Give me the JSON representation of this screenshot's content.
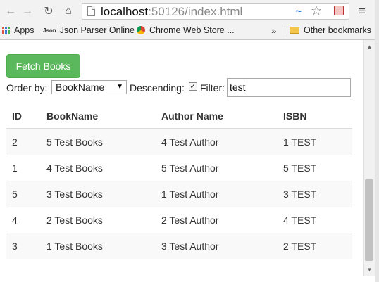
{
  "browser": {
    "url_host": "localhost",
    "url_path": ":50126/index.html",
    "back_icon": "←",
    "forward_icon": "→",
    "reload_icon": "↻",
    "home_icon": "⌂",
    "star_icon": "☆",
    "menu_icon": "≡",
    "ext_icon": "~"
  },
  "bookmarks": {
    "apps": "Apps",
    "json_icon": "Json",
    "json_parser": "Json Parser Online",
    "chrome_store": "Chrome Web Store ...",
    "chevron": "»",
    "other": "Other bookmarks"
  },
  "page": {
    "fetch_button": "Fetch Books",
    "order_by_label": "Order by:",
    "order_by_value": "BookName",
    "descending_label": "Descending:",
    "descending_checked": true,
    "filter_label": "Filter:",
    "filter_value": "test"
  },
  "table": {
    "headers": [
      "ID",
      "BookName",
      "Author Name",
      "ISBN"
    ],
    "rows": [
      [
        "2",
        "5 Test Books",
        "4 Test Author",
        "1 TEST"
      ],
      [
        "1",
        "4 Test Books",
        "5 Test Author",
        "5 TEST"
      ],
      [
        "5",
        "3 Test Books",
        "1 Test Author",
        "3 TEST"
      ],
      [
        "4",
        "2 Test Books",
        "2 Test Author",
        "4 TEST"
      ],
      [
        "3",
        "1 Test Books",
        "3 Test Author",
        "2 TEST"
      ]
    ]
  },
  "scrollbar": {
    "up": "▲",
    "down": "▼"
  },
  "colors": {
    "fetch_button": "#5cb85c",
    "stripe": "#f9f9f9"
  }
}
